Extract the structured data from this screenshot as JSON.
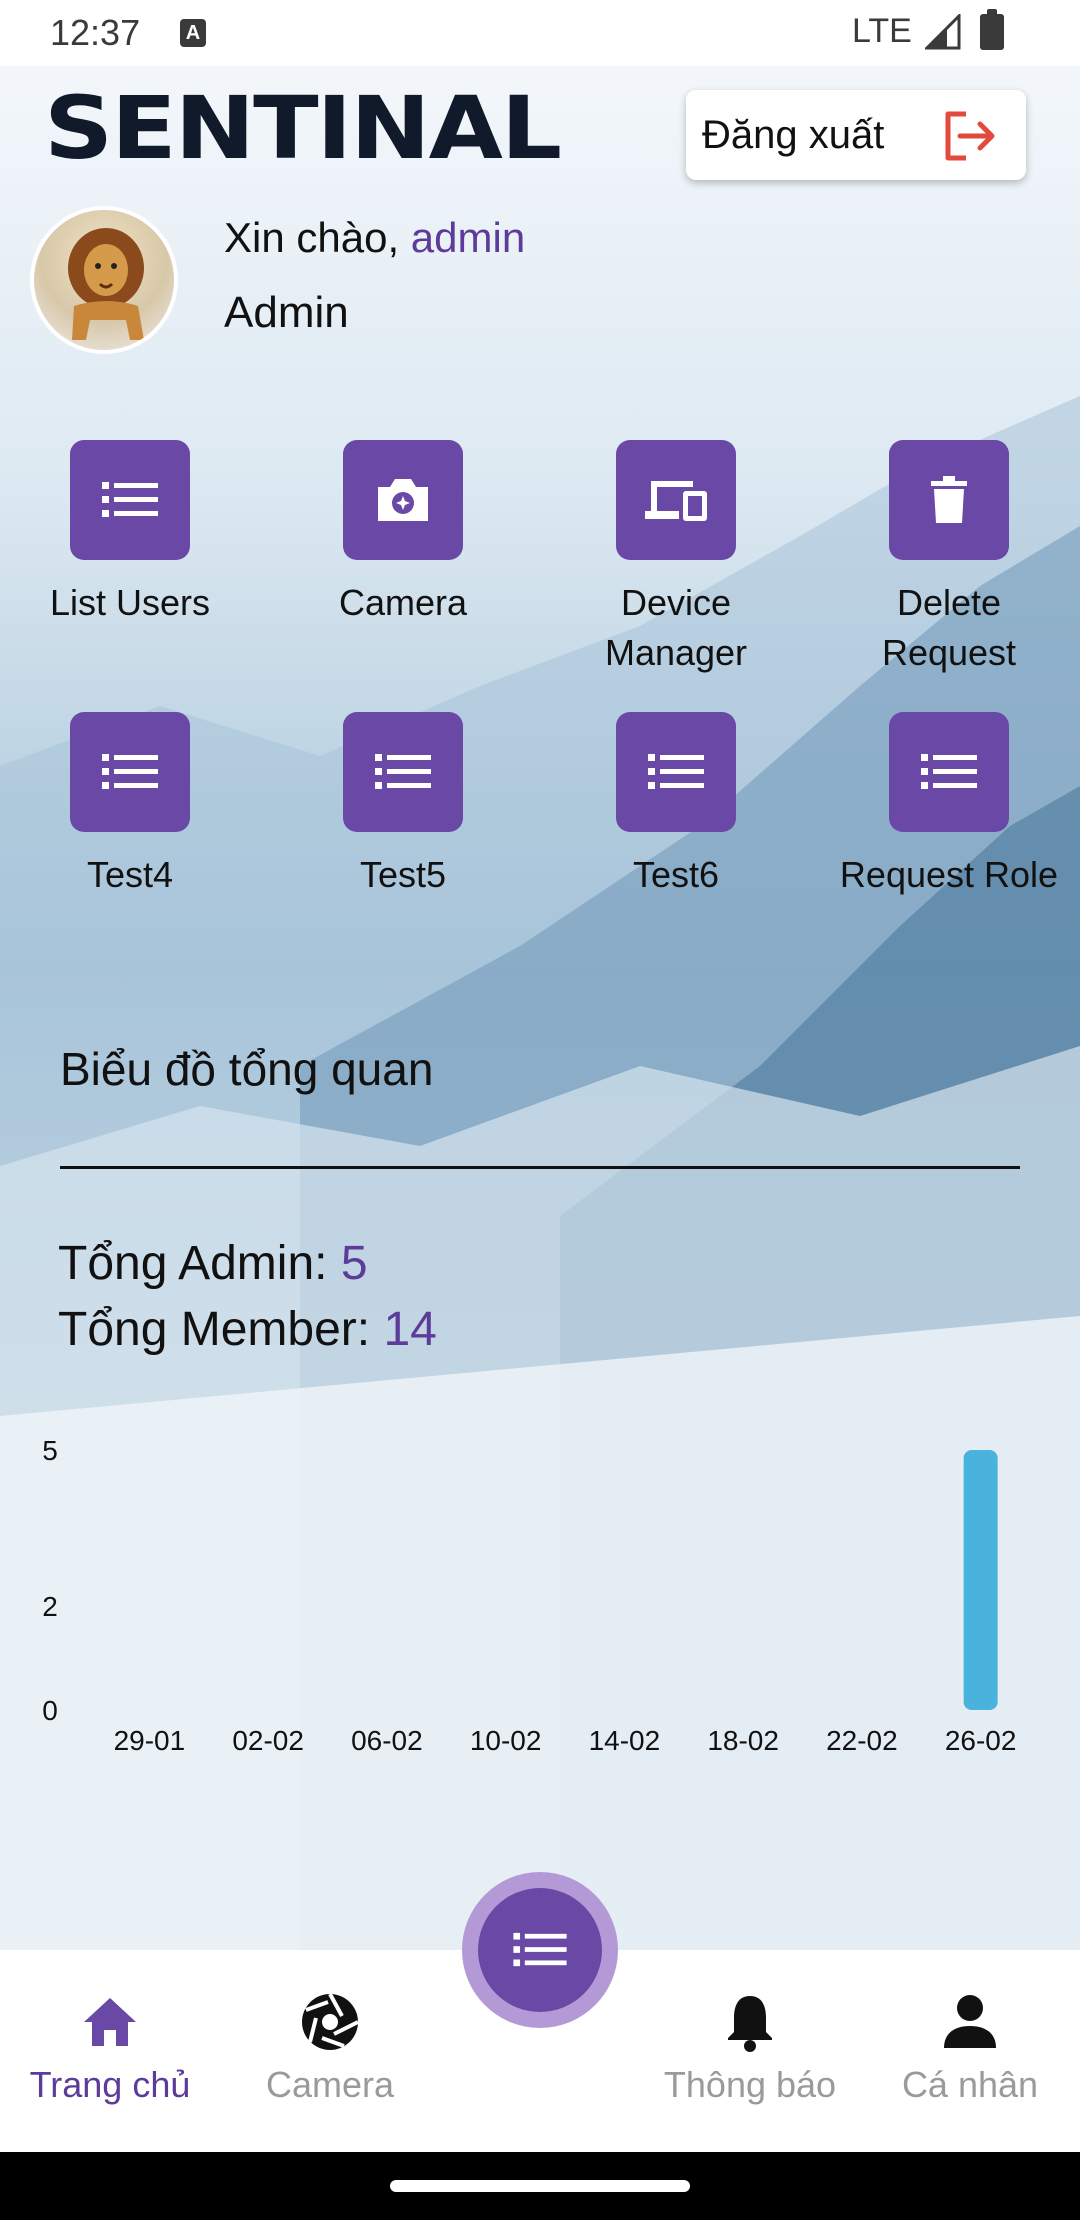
{
  "status_bar": {
    "time": "12:37",
    "network": "LTE"
  },
  "header": {
    "logo_text": "SENTINAL",
    "logout_label": "Đăng xuất",
    "greeting_prefix": "Xin chào, ",
    "username": "admin",
    "role": "Admin"
  },
  "actions": [
    {
      "label": "List Users",
      "icon": "list-icon"
    },
    {
      "label": "Camera",
      "icon": "camera-icon"
    },
    {
      "label": "Device Manager",
      "icon": "devices-icon"
    },
    {
      "label": "Delete Request",
      "icon": "trash-icon"
    },
    {
      "label": "Test4",
      "icon": "list-icon"
    },
    {
      "label": "Test5",
      "icon": "list-icon"
    },
    {
      "label": "Test6",
      "icon": "list-icon"
    },
    {
      "label": "Request Role",
      "icon": "list-icon"
    }
  ],
  "overview": {
    "title": "Biểu đồ tổng quan",
    "admin_label": "Tổng Admin: ",
    "admin_value": "5",
    "member_label": "Tổng Member: ",
    "member_value": "14"
  },
  "chart_data": {
    "type": "bar",
    "title": "",
    "xlabel": "",
    "ylabel": "",
    "categories": [
      "29-01",
      "02-02",
      "06-02",
      "10-02",
      "14-02",
      "18-02",
      "22-02",
      "26-02"
    ],
    "values": [
      0,
      0,
      0,
      0,
      0,
      0,
      0,
      5
    ],
    "y_ticks": [
      0,
      2,
      5
    ],
    "ylim": [
      0,
      5
    ],
    "grid": false,
    "bar_color": "#4ab3dd"
  },
  "bottom_nav": {
    "items": [
      {
        "label": "Trang chủ",
        "icon": "home-icon",
        "active": true
      },
      {
        "label": "Camera",
        "icon": "shutter-icon",
        "active": false
      },
      {
        "label": "Thông báo",
        "icon": "bell-icon",
        "active": false
      },
      {
        "label": "Cá nhân",
        "icon": "person-icon",
        "active": false
      }
    ],
    "fab_icon": "list-icon"
  },
  "colors": {
    "accent": "#6a48a5",
    "accent_text": "#5c3c98",
    "logout_icon": "#e24a3b",
    "chart_bar": "#4ab3dd",
    "inactive_nav": "#9a9a9a"
  }
}
